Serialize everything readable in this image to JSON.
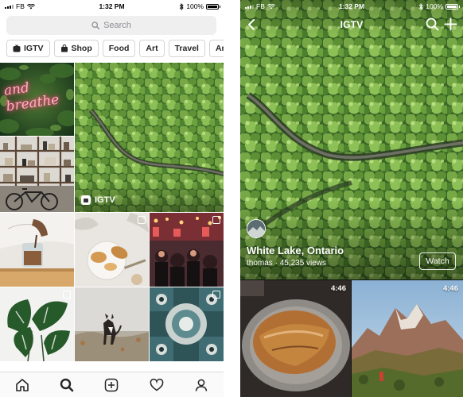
{
  "left_screen": {
    "status": {
      "carrier": "FB",
      "time": "1:32 PM",
      "battery": "100%"
    },
    "search": {
      "placeholder": "Search"
    },
    "chips": [
      {
        "label": "IGTV",
        "icon": "igtv-icon"
      },
      {
        "label": "Shop",
        "icon": "shopping-bag-icon"
      },
      {
        "label": "Food"
      },
      {
        "label": "Art"
      },
      {
        "label": "Travel"
      },
      {
        "label": "Ar"
      }
    ],
    "featured": {
      "label": "IGTV",
      "icon": "igtv-icon"
    },
    "neon_text": "and breathe",
    "tabs": [
      "home-icon",
      "search-icon",
      "new-post-icon",
      "heart-icon",
      "profile-icon"
    ]
  },
  "right_screen": {
    "status": {
      "carrier": "FB",
      "time": "1:32 PM",
      "battery": "100%"
    },
    "header": {
      "title": "IGTV",
      "back_icon": "chevron-left-icon",
      "search_icon": "search-icon",
      "plus_icon": "plus-icon"
    },
    "video": {
      "title": "White Lake, Ontario",
      "author": "thomas",
      "views": "45,235 views",
      "watch_label": "Watch"
    },
    "thumbnails": [
      {
        "duration": "4:46",
        "subject": "bread"
      },
      {
        "duration": "4:46",
        "subject": "mountains"
      }
    ]
  },
  "colors": {
    "forest_dark": "#2f4a22",
    "forest_light": "#8fbf54",
    "chip_border": "#d4d4d4",
    "search_bg": "#efeff0"
  }
}
